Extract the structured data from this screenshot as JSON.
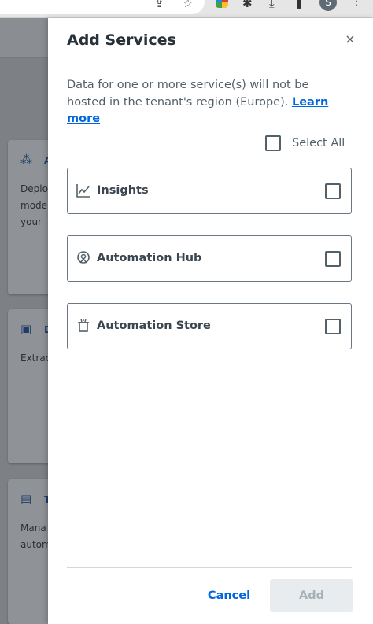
{
  "browser": {
    "profile_initial": "S"
  },
  "background_page": {
    "cards": [
      {
        "icon": "apps-icon",
        "title": "A",
        "text_lines": [
          "Deplo",
          "mode",
          "your"
        ]
      },
      {
        "icon": "document-understanding-icon",
        "title": "D",
        "text_lines": [
          "Extrac"
        ]
      },
      {
        "icon": "task-icon",
        "title": "T",
        "text_lines": [
          "Mana",
          "autom"
        ]
      }
    ]
  },
  "drawer": {
    "title": "Add Services",
    "close_label": "×",
    "notice_text": "Data for one or more service(s) will not be hosted in the tenant's region (Europe).",
    "notice_link": "Learn more",
    "select_all_label": "Select All",
    "services": [
      {
        "name": "Insights",
        "icon": "chart-line-icon",
        "checked": false
      },
      {
        "name": "Automation Hub",
        "icon": "bulb-icon",
        "checked": false
      },
      {
        "name": "Automation Store",
        "icon": "store-icon",
        "checked": false
      }
    ],
    "cancel_label": "Cancel",
    "add_label": "Add"
  },
  "colors": {
    "accent": "#0067df",
    "text": "#273139",
    "muted": "#526069",
    "disabled_bg": "#e9ecee",
    "disabled_text": "#a4b1b8"
  }
}
